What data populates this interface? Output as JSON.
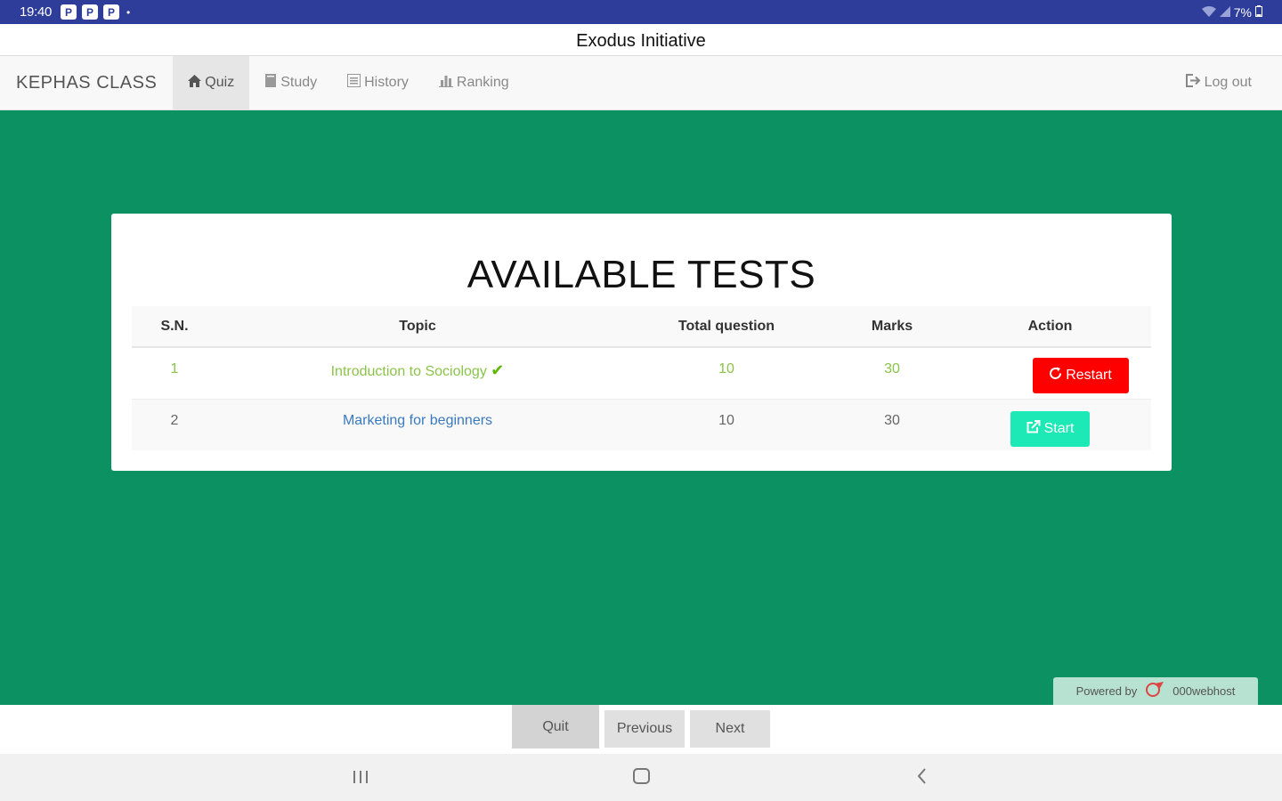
{
  "status_bar": {
    "time": "19:40",
    "notifications": [
      "P",
      "P",
      "P"
    ],
    "battery": "7%"
  },
  "app_title": "Exodus Initiative",
  "nav": {
    "brand": "KEPHAS CLASS",
    "items": [
      {
        "label": "Quiz",
        "icon": "home-icon",
        "active": true
      },
      {
        "label": "Study",
        "icon": "book-icon",
        "active": false
      },
      {
        "label": "History",
        "icon": "list-icon",
        "active": false
      },
      {
        "label": "Ranking",
        "icon": "bar-chart-icon",
        "active": false
      }
    ],
    "logout": "Log out"
  },
  "panel": {
    "title": "AVAILABLE TESTS",
    "headers": [
      "S.N.",
      "Topic",
      "Total question",
      "Marks",
      "Action"
    ],
    "rows": [
      {
        "sn": "1",
        "topic": "Introduction to Sociology",
        "total": "10",
        "marks": "30",
        "action": "Restart",
        "completed": true
      },
      {
        "sn": "2",
        "topic": "Marketing for beginners",
        "total": "10",
        "marks": "30",
        "action": "Start",
        "completed": false
      }
    ]
  },
  "powered": {
    "prefix": "Powered by",
    "brand": "000webhost"
  },
  "bottom_buttons": {
    "quit": "Quit",
    "previous": "Previous",
    "next": "Next"
  },
  "colors": {
    "background": "#0c9262",
    "restart": "#ff0000",
    "start": "#1de9b6",
    "completed_text": "#8bc34a"
  }
}
